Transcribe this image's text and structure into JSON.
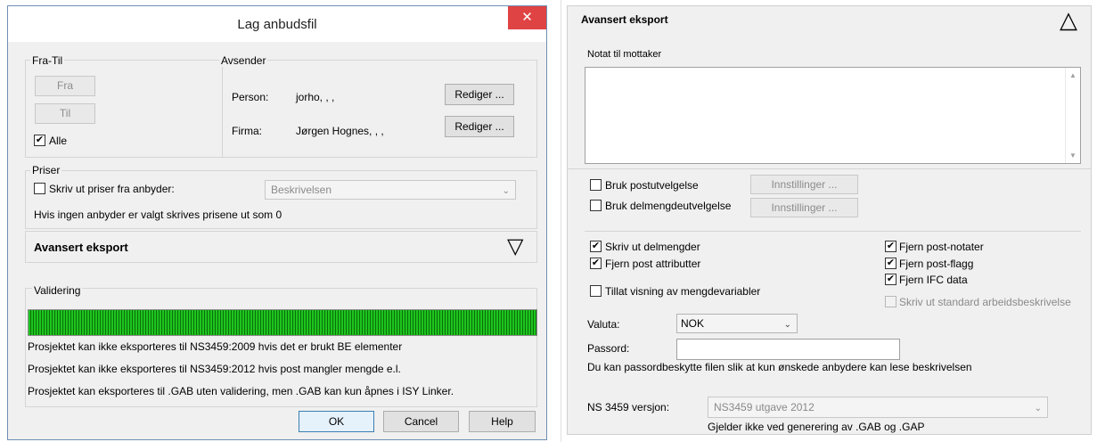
{
  "dialog": {
    "title": "Lag anbudsfil",
    "close_symbol": "✕",
    "fra_til": {
      "label": "Fra-Til",
      "fra_button": "Fra",
      "til_button": "Til",
      "alle_label": "Alle",
      "alle_checked": true
    },
    "avsender": {
      "label": "Avsender",
      "person_label": "Person:",
      "person_value": "jorho, , ,",
      "firma_label": "Firma:",
      "firma_value": "Jørgen Hognes, , ,",
      "rediger_label": "Rediger ..."
    },
    "priser": {
      "label": "Priser",
      "checkbox_label": "Skriv ut priser fra anbyder:",
      "checked": false,
      "select_value": "Beskrivelsen",
      "info": "Hvis ingen anbyder er valgt skrives prisene ut som 0"
    },
    "avansert": {
      "label": "Avansert eksport",
      "toggle_symbol": "▽"
    },
    "validering": {
      "label": "Validering",
      "progress": 1.0,
      "messages": [
        "Prosjektet kan ikke eksporteres til NS3459:2009 hvis det er brukt BE elementer",
        "Prosjektet kan ikke eksporteres til NS3459:2012 hvis post mangler mengde e.l.",
        "Prosjektet kan eksporteres til .GAB uten validering, men .GAB kan kun åpnes i ISY Linker."
      ]
    },
    "buttons": {
      "ok": "OK",
      "cancel": "Cancel",
      "help": "Help"
    }
  },
  "advanced_panel": {
    "title": "Avansert eksport",
    "collapse_symbol": "△",
    "notat_label": "Notat til mottaker",
    "notat_value": "",
    "bruk_postutvelgelse": {
      "label": "Bruk postutvelgelse",
      "checked": false
    },
    "bruk_delmengdeutvelgelse": {
      "label": "Bruk delmengdeutvelgelse",
      "checked": false
    },
    "innstillinger_label": "Innstillinger ...",
    "options_left": [
      {
        "label": "Skriv ut delmengder",
        "checked": true
      },
      {
        "label": "Fjern post attributter",
        "checked": true
      },
      {
        "label": "Tillat visning av mengdevariabler",
        "checked": false
      }
    ],
    "options_right": [
      {
        "label": "Fjern post-notater",
        "checked": true
      },
      {
        "label": "Fjern post-flagg",
        "checked": true
      },
      {
        "label": "Fjern IFC data",
        "checked": true
      },
      {
        "label": "Skriv ut standard arbeidsbeskrivelse",
        "checked": false,
        "disabled": true
      }
    ],
    "valuta_label": "Valuta:",
    "valuta_value": "NOK",
    "passord_label": "Passord:",
    "passord_value": "",
    "passord_info": "Du kan passordbeskytte filen slik at kun ønskede anbydere kan lese beskrivelsen",
    "ns_label": "NS 3459 versjon:",
    "ns_value": "NS3459 utgave 2012",
    "ns_info": "Gjelder ikke ved generering av .GAB og .GAP"
  }
}
